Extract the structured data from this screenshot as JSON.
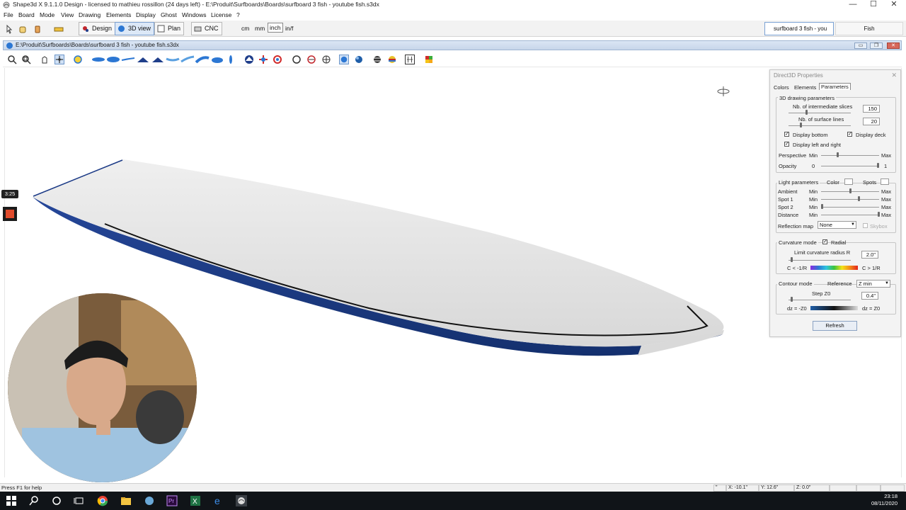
{
  "window": {
    "title": "Shape3d X 9.1.1.0 Design - licensed to mathieu rossillon (24 days left) - E:\\Produit\\Surfboards\\Boards\\surfboard 3 fish - youtube fish.s3dx",
    "minimize": "—",
    "maximize": "☐",
    "close": "✕"
  },
  "menu": [
    "File",
    "Board",
    "Mode",
    "View",
    "Drawing",
    "Elements",
    "Display",
    "Ghost",
    "Windows",
    "License",
    "?"
  ],
  "toolbar": {
    "modes": [
      "Design",
      "3D view",
      "Plan",
      "CNC"
    ],
    "active_mode": "3D view",
    "units": [
      "cm",
      "mm",
      "inch",
      "in/f"
    ],
    "active_unit": "inch",
    "board_select": "surfboard 3 fish - you",
    "board_name": "Fish"
  },
  "document": {
    "title": "E:\\Produit\\Surfboards\\Boards\\surfboard 3 fish - youtube fish.s3dx",
    "buttons": [
      "▭",
      "❐",
      "✕"
    ]
  },
  "properties": {
    "title": "Direct3D Properties",
    "close": "✕",
    "tabs": [
      "Colors",
      "Elements",
      "Parameters"
    ],
    "active_tab": "Parameters",
    "drawing": {
      "label": "3D drawing parameters",
      "slices_label": "Nb. of intermediate slices",
      "slices_value": "150",
      "lines_label": "Nb. of surface lines",
      "lines_value": "20",
      "display_bottom": "Display bottom",
      "display_deck": "Display deck",
      "display_lr": "Display left and right",
      "perspective": "Perspective",
      "opacity": "Opacity",
      "min": "Min",
      "max": "Max",
      "opacity_min": "0",
      "opacity_max": "1"
    },
    "light": {
      "label": "Light parameters",
      "color": "Color",
      "spots": "Spots",
      "ambient": "Ambient",
      "spot1": "Spot 1",
      "spot2": "Spot 2",
      "distance": "Distance",
      "reflection": "Reflection map",
      "reflection_value": "None",
      "skybox": "Skybox"
    },
    "curvature": {
      "label": "Curvature mode",
      "radial": "Radial",
      "limit_label": "Limit curvature radius R",
      "limit_value": "2.0\"",
      "left": "C < -1/R",
      "right": "C > 1/R"
    },
    "contour": {
      "label": "Contour mode",
      "reference": "Reference",
      "reference_value": "Z min",
      "step_label": "Step Z0",
      "step_value": "0.4\"",
      "left": "dz = -Z0",
      "right": "dz = Z0"
    },
    "refresh": "Refresh"
  },
  "overlay": {
    "timer": "3:25"
  },
  "status": {
    "message": "Press F1 for help",
    "unit": "\"",
    "x": "X: -10.1\"",
    "y": "Y: 12.6\"",
    "z": "Z: 0.0\""
  },
  "taskbar": {
    "time": "23:18",
    "date": "08/11/2020"
  },
  "colors": {
    "rail": "#1b3a86",
    "deck": "#dedede",
    "accent": "#2c77d3"
  }
}
